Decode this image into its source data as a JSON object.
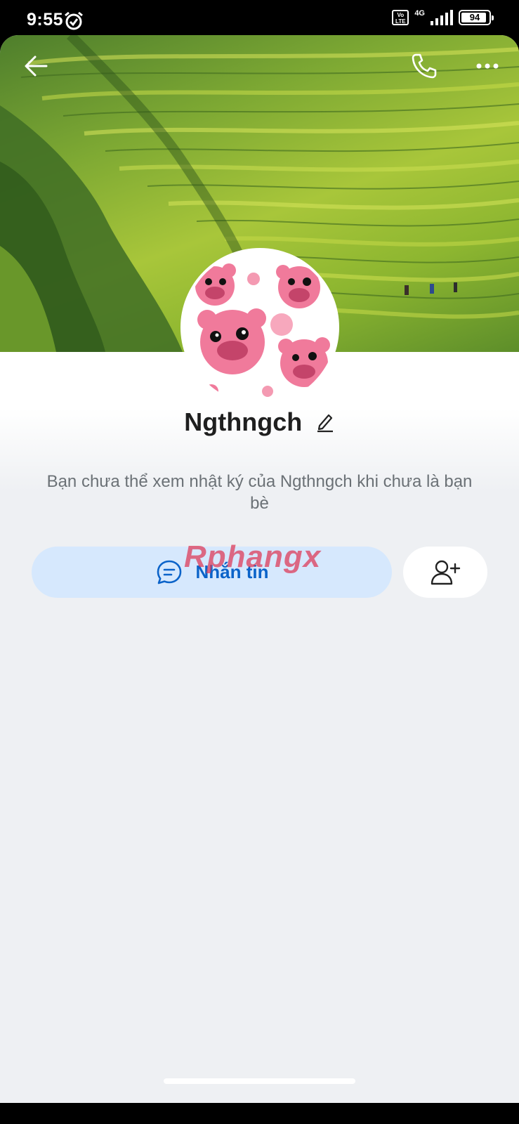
{
  "status_bar": {
    "time": "9:55",
    "volte": "Vo LTE",
    "network": "4G",
    "battery": "94"
  },
  "header": {
    "back_icon": "arrow-left-icon",
    "call_icon": "phone-icon",
    "more_icon": "more-horizontal-icon"
  },
  "profile": {
    "name": "Ngthngch",
    "notice": "Bạn chưa thể xem nhật ký của Ngthngch khi chưa là bạn bè"
  },
  "actions": {
    "message_label": "Nhắn tin",
    "message_icon": "chat-bubble-icon",
    "add_friend_icon": "add-user-icon"
  },
  "watermark": "Rphangx",
  "colors": {
    "primary_button_bg": "#d6e8fd",
    "primary_button_text": "#0b63c9",
    "page_bg": "#eef0f3"
  }
}
